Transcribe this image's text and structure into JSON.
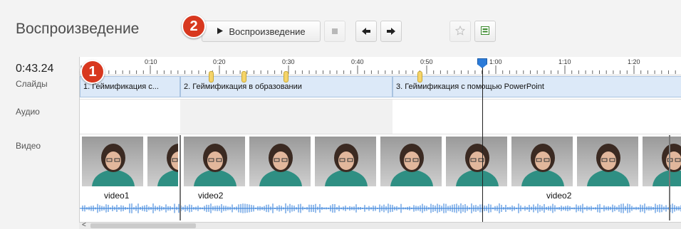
{
  "header": {
    "title": "Воспроизведение",
    "play_label": "Воспроизведение",
    "badges": [
      "2",
      "1"
    ]
  },
  "timeline": {
    "current_time": "0:43.24",
    "row_labels": {
      "slides": "Слайды",
      "audio": "Аудио",
      "video": "Видео"
    },
    "ruler_ticks": [
      "0:10",
      "0:20",
      "0:30",
      "0:40",
      "0:50",
      "1:00",
      "1:10",
      "1:20"
    ],
    "slides": [
      {
        "label": "1. Геймификация с..."
      },
      {
        "label": "2. Геймификация в образовании"
      },
      {
        "label": "3. Геймификация с помощью PowerPoint"
      }
    ],
    "clips": [
      "video1",
      "video2",
      "video2"
    ]
  },
  "colors": {
    "accent": "#2c7bd8",
    "badge": "#d8381f",
    "slide_bg": "#dce9f8",
    "marker": "#f5d46a"
  },
  "icons": [
    "play-icon",
    "stop-icon",
    "arrow-left-icon",
    "arrow-right-icon",
    "star-icon",
    "note-icon",
    "scroll-left-icon"
  ]
}
